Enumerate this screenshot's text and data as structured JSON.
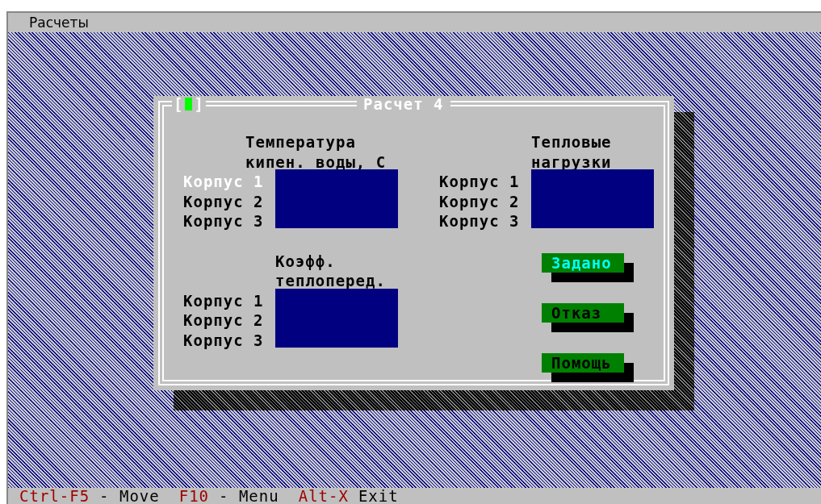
{
  "menu_bar": {
    "items": [
      "Расчеты"
    ]
  },
  "dialog": {
    "close_box": "[■]",
    "title": "Расчет 4",
    "groups": [
      {
        "title_lines": [
          "Температура",
          "кипен. воды, С"
        ],
        "rows": [
          {
            "label": "Корпус 1",
            "selected": true
          },
          {
            "label": "Корпус 2",
            "selected": false
          },
          {
            "label": "Корпус 3",
            "selected": false
          }
        ]
      },
      {
        "title_lines": [
          "Тепловые",
          "нагрузки"
        ],
        "rows": [
          {
            "label": "Корпус 1",
            "selected": false
          },
          {
            "label": "Корпус 2",
            "selected": false
          },
          {
            "label": "Корпус 3",
            "selected": false
          }
        ]
      },
      {
        "title_lines": [
          "Коэфф.",
          "теплоперед."
        ],
        "rows": [
          {
            "label": "Корпус 1",
            "selected": false
          },
          {
            "label": "Корпус 2",
            "selected": false
          },
          {
            "label": "Корпус 3",
            "selected": false
          }
        ]
      }
    ],
    "buttons": [
      {
        "label": "Задано",
        "default": true
      },
      {
        "label": "Отказ",
        "default": false
      },
      {
        "label": "Помощь",
        "default": false
      }
    ]
  },
  "status_bar": [
    {
      "key": "Ctrl-F5",
      "label": "- Move"
    },
    {
      "key": "F10",
      "label": "- Menu"
    },
    {
      "key": "Alt-X",
      "label": "Exit"
    }
  ]
}
